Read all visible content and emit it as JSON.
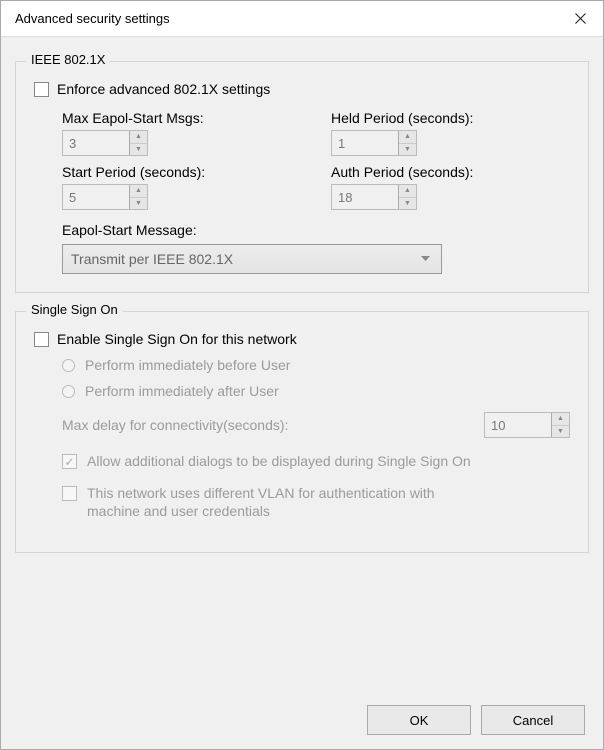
{
  "title": "Advanced security settings",
  "ieee": {
    "group_label": "IEEE 802.1X",
    "enforce_label": "Enforce advanced 802.1X settings",
    "enforce_checked": false,
    "fields": {
      "max_eapol_label": "Max Eapol-Start Msgs:",
      "max_eapol_value": "3",
      "held_label": "Held Period (seconds):",
      "held_value": "1",
      "start_label": "Start Period (seconds):",
      "start_value": "5",
      "auth_label": "Auth Period (seconds):",
      "auth_value": "18"
    },
    "eapol_msg_label": "Eapol-Start Message:",
    "eapol_msg_value": "Transmit per IEEE 802.1X"
  },
  "sso": {
    "group_label": "Single Sign On",
    "enable_label": "Enable Single Sign On for this network",
    "enable_checked": false,
    "radio_before": "Perform immediately before User",
    "radio_after": "Perform immediately after User",
    "max_delay_label": "Max delay for connectivity(seconds):",
    "max_delay_value": "10",
    "allow_dialogs_label": "Allow additional dialogs to be displayed during Single Sign On",
    "allow_dialogs_checked": true,
    "vlan_label": "This network uses different VLAN for authentication with machine and user credentials",
    "vlan_checked": false
  },
  "buttons": {
    "ok": "OK",
    "cancel": "Cancel"
  }
}
